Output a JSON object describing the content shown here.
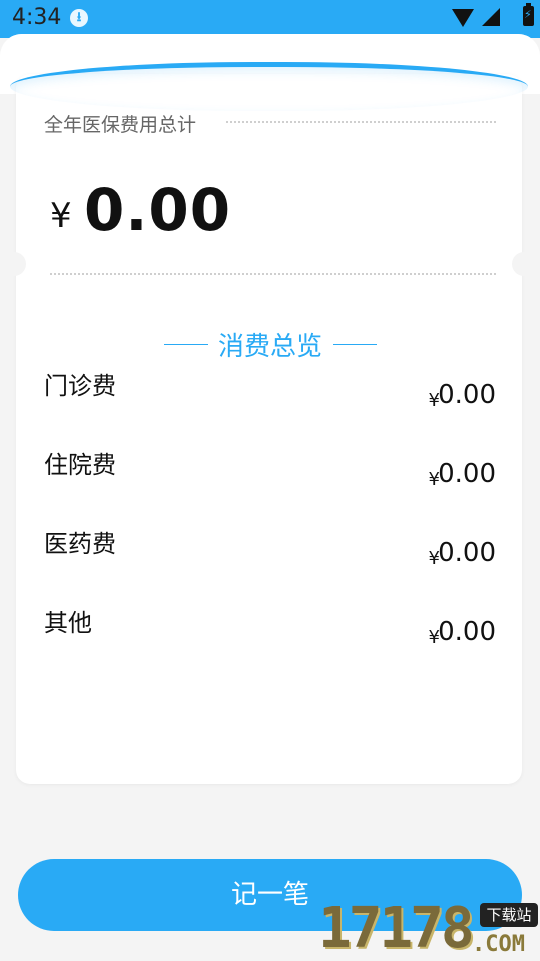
{
  "status": {
    "time": "4:34",
    "download_glyph": "⭳",
    "battery_glyph": "⚡",
    "icons": [
      "download-icon",
      "wifi-icon",
      "signal-icon",
      "battery-icon"
    ]
  },
  "summary": {
    "label": "全年医保费用总计",
    "currency": "¥",
    "total": "0.00"
  },
  "overview": {
    "title": "消费总览",
    "items": [
      {
        "label": "门诊费",
        "currency": "¥",
        "amount": "0.00"
      },
      {
        "label": "住院费",
        "currency": "¥",
        "amount": "0.00"
      },
      {
        "label": "医药费",
        "currency": "¥",
        "amount": "0.00"
      },
      {
        "label": "其他",
        "currency": "¥",
        "amount": "0.00"
      }
    ]
  },
  "action": {
    "record_label": "记一笔"
  },
  "watermark": {
    "digits": "17178",
    "badge": "下载站",
    "domain": ".COM"
  },
  "colors": {
    "accent": "#29aaf5",
    "background": "#f4f4f4",
    "card": "#ffffff",
    "text": "#111111"
  }
}
